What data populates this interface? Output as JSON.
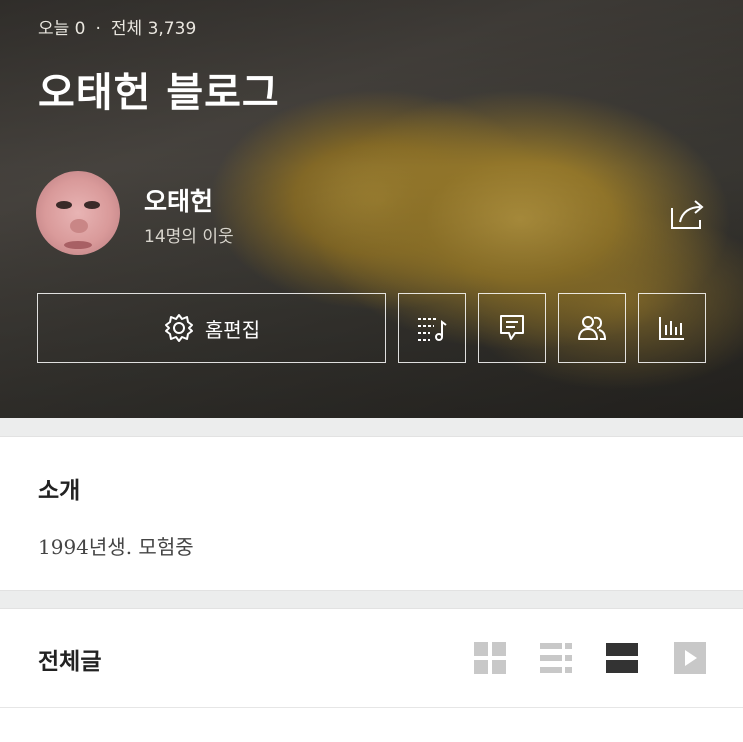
{
  "header": {
    "visit_today": "오늘 0",
    "visit_sep": "·",
    "visit_total": "전체 3,739",
    "blog_title": "오태헌 블로그"
  },
  "profile": {
    "name": "오태헌",
    "neighbors": "14명의 이웃"
  },
  "actions": {
    "home_edit_label": "홈편집",
    "icons": [
      "playlist-music-icon",
      "chat-icon",
      "people-icon",
      "stats-icon"
    ],
    "share_icon": "share-icon"
  },
  "intro": {
    "heading": "소개",
    "text": "1994년생. 모험중"
  },
  "posts": {
    "heading": "전체글",
    "view_modes": [
      "grid-view-icon",
      "list-view-icon",
      "card-view-icon",
      "video-view-icon"
    ],
    "active_view": "card-view-icon"
  },
  "colors": {
    "inactive_icon": "#c8c8c8",
    "active_icon": "#333333"
  }
}
